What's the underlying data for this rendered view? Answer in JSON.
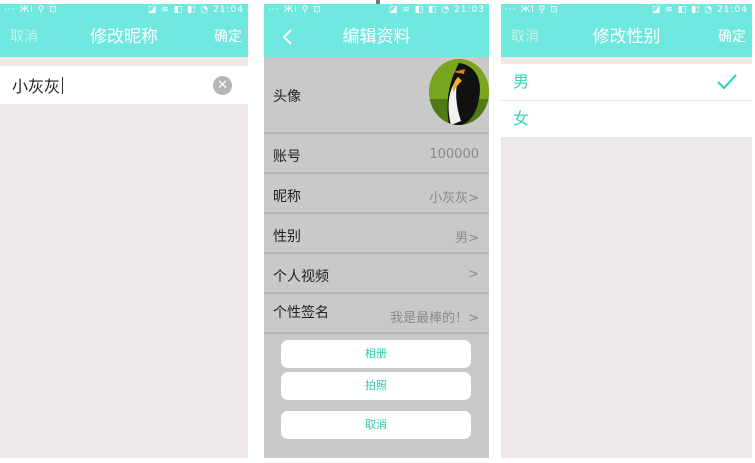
{
  "status_bar": {
    "left": "··· ЖІ ⚲ ⊡",
    "right_1": "◪ ≋ ◧ ◧ ◔ 21:04",
    "right_2": "◪ ≋ ◧ ◧ ◔ 21:03",
    "right_3": "◪ ≋ ◧ ◧ ◔ 21:04"
  },
  "edit_nickname": {
    "title": "修改昵称",
    "cancel_label": "取消",
    "confirm_label": "确定",
    "nickname_value": "小灰灰"
  },
  "edit_profile": {
    "title": "编辑资料",
    "avatar_label": "头像",
    "rows": [
      {
        "label": "账号",
        "value": "100000"
      },
      {
        "label": "昵称",
        "value": "小灰灰>"
      },
      {
        "label": "性别",
        "value": "男>"
      },
      {
        "label": "个人视频",
        "value": ">"
      },
      {
        "label": "个性签名",
        "value": "我是最棒的！>"
      }
    ],
    "sheet": {
      "album_label": "相册",
      "camera_label": "拍照",
      "cancel_label": "取消"
    }
  },
  "edit_gender": {
    "title": "修改性别",
    "cancel_label": "取消",
    "confirm_label": "确定",
    "options": [
      "男",
      "女"
    ],
    "selected_option": "男"
  },
  "colors": {
    "header": "#6fe8e0",
    "accent_text": "#38d3b8",
    "background": "#efe8e8"
  }
}
